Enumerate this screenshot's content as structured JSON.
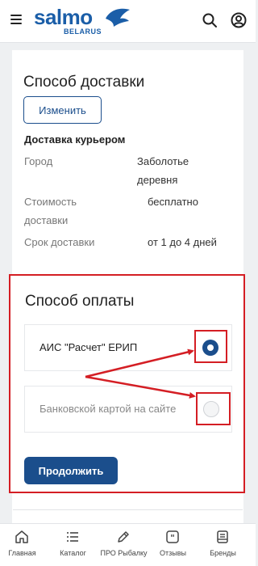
{
  "header": {
    "logo_text": "salmo",
    "logo_subtext": "BELARUS",
    "menu_icon": "menu-icon",
    "search_icon": "search-icon",
    "account_icon": "user-icon"
  },
  "delivery": {
    "title": "Способ доставки",
    "change_label": "Изменить",
    "method": "Доставка курьером",
    "rows": [
      {
        "label": "Город",
        "value": "Заболотье деревня"
      },
      {
        "label": "Стоимость доставки",
        "value": "бесплатно"
      },
      {
        "label": "Срок доставки",
        "value": "от 1 до 4 дней"
      }
    ]
  },
  "payment": {
    "title": "Способ оплаты",
    "options": [
      {
        "label": "АИС \"Расчет\" ЕРИП",
        "selected": true
      },
      {
        "label": "Банковской картой на сайте",
        "selected": false
      }
    ],
    "continue_label": "Продолжить"
  },
  "bottom_nav": {
    "items": [
      {
        "label": "Главная",
        "icon": "home-icon"
      },
      {
        "label": "Каталог",
        "icon": "catalog-list-icon"
      },
      {
        "label": "ПРО Рыбалку",
        "icon": "edit-pen-icon"
      },
      {
        "label": "Отзывы",
        "icon": "quote-bubble-icon"
      },
      {
        "label": "Бренды",
        "icon": "brand-tag-icon"
      }
    ]
  },
  "colors": {
    "brand_blue": "#1b4e8c",
    "logo_blue": "#1b5ea8",
    "annotation_red": "#d41e24",
    "background": "#eef0f2"
  }
}
